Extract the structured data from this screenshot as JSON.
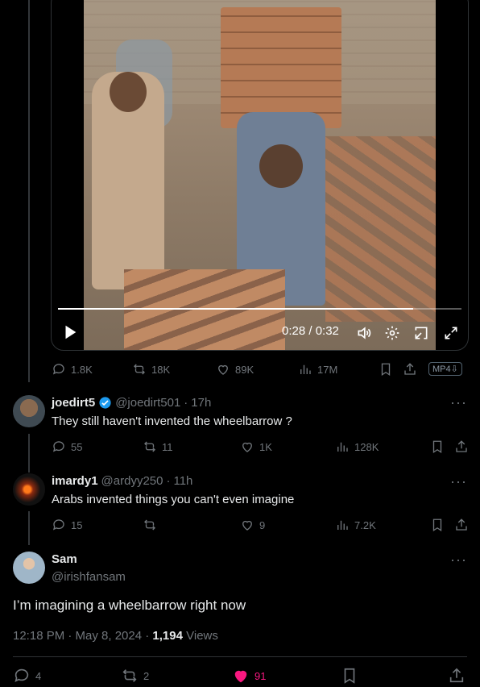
{
  "video": {
    "time": "0:28 / 0:32",
    "progress": 0.88,
    "badge": "MP4",
    "badge_sub": "⇩"
  },
  "video_actions": {
    "replies": "1.8K",
    "reposts": "18K",
    "likes": "89K",
    "views": "17M"
  },
  "replies": [
    {
      "name": "joedirt5",
      "handle": "@joedirt501",
      "time_ago": "17h",
      "verified": true,
      "text": "They still haven't invented the wheelbarrow ?",
      "stats": {
        "replies": "55",
        "reposts": "11",
        "likes": "1K",
        "views": "128K"
      }
    },
    {
      "name": "imardy1",
      "handle": "@ardyy250",
      "time_ago": "11h",
      "verified": false,
      "text": "Arabs invented things you can't even imagine",
      "stats": {
        "replies": "15",
        "reposts": "",
        "likes": "9",
        "views": "7.2K"
      }
    }
  ],
  "main_tweet": {
    "name": "Sam",
    "handle": "@irishfansam",
    "text": "I’m imagining a wheelbarrow right now",
    "timestamp": "12:18 PM · May 8, 2024 · ",
    "views_count": "1,194",
    "views_label": " Views",
    "stats": {
      "replies": "4",
      "reposts": "2",
      "likes": "91"
    }
  },
  "colors": {
    "like_active": "#f91880",
    "verified": "#1d9bf0",
    "muted": "#71767b"
  }
}
